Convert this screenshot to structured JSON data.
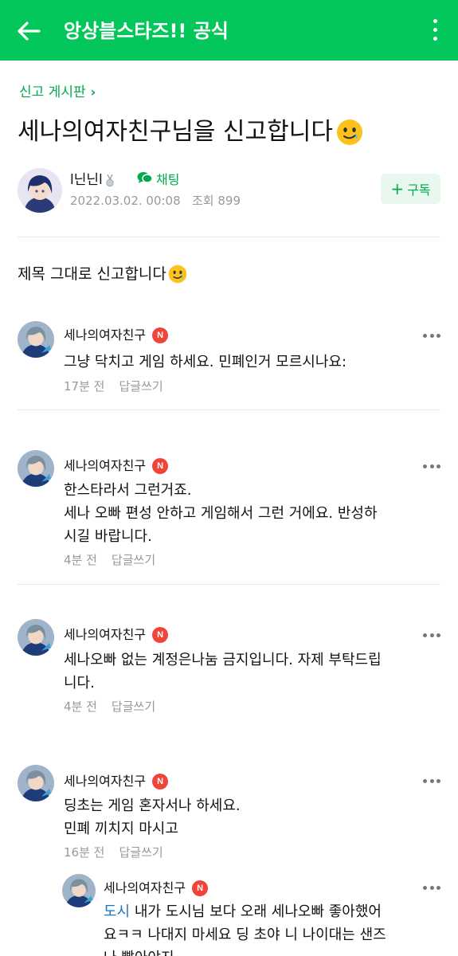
{
  "header": {
    "title": "앙상블스타즈!! 공식",
    "back_icon": "arrow-left-icon",
    "more_icon": "more-vertical-icon",
    "bg_color": "#03c75a"
  },
  "post": {
    "board": "신고 게시판",
    "title": "세나의여자친구님을 신고합니다",
    "author": "l닌닌l",
    "chat_label": "채팅",
    "date": "2022.03.02. 00:08",
    "views": "조회 899",
    "subscribe_label": "구독",
    "body": "제목 그대로 신고합니다"
  },
  "comments": [
    {
      "name": "세나의여자친구",
      "badge": "N",
      "text": "그냥 닥치고 게임 하세요. 민폐인거 모르시나요:",
      "time": "17분 전",
      "reply_label": "답글쓰기"
    },
    {
      "name": "세나의여자친구",
      "badge": "N",
      "text_lines": [
        "한스타라서 그런거죠.",
        "세나 오빠 편성 안하고 게임해서 그런 거에요. 반성하",
        "시길 바랍니다."
      ],
      "time": "4분 전",
      "reply_label": "답글쓰기"
    },
    {
      "name": "세나의여자친구",
      "badge": "N",
      "text_lines": [
        "세나오빠 없는 계정은나눔 금지입니다. 자제 부탁드립",
        "니다."
      ],
      "time": "4분 전",
      "reply_label": "답글쓰기"
    },
    {
      "name": "세나의여자친구",
      "badge": "N",
      "text_lines": [
        "딩초는 게임 혼자서나 하세요.",
        "민폐 끼치지 마시고"
      ],
      "time": "16분 전",
      "reply_label": "답글쓰기"
    }
  ],
  "reply": {
    "name": "세나의여자친구",
    "badge": "N",
    "mention": "도시",
    "line1_rest": " 내가 도시님 보다 오래 세나오빠 좋아했어",
    "line2": "요ㅋㅋ 나대지 마세요 딩 초야 니 나이대는 샌즈",
    "line3": "나 빨아야지"
  }
}
